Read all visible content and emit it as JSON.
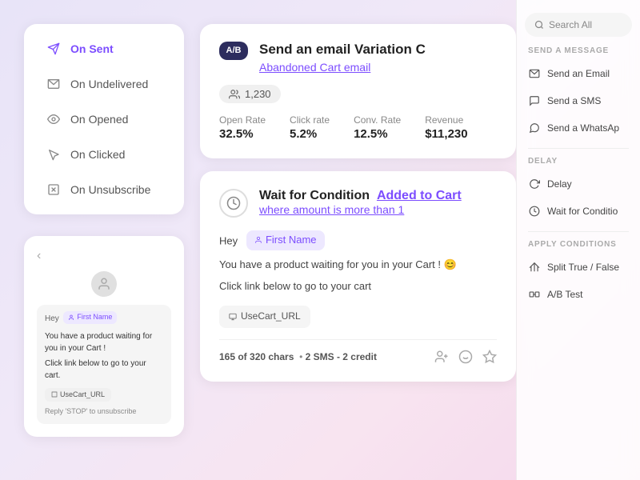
{
  "sidebar": {
    "items": [
      {
        "id": "on-sent",
        "label": "On Sent",
        "active": true
      },
      {
        "id": "on-undelivered",
        "label": "On Undelivered",
        "active": false
      },
      {
        "id": "on-opened",
        "label": "On Opened",
        "active": false
      },
      {
        "id": "on-clicked",
        "label": "On Clicked",
        "active": false
      },
      {
        "id": "on-unsubscribe",
        "label": "On Unsubscribe",
        "active": false
      }
    ]
  },
  "preview": {
    "back": "‹",
    "hey": "Hey",
    "name_placeholder": "First Name",
    "body1": "You have a product waiting for you in your Cart !",
    "body2": "Click link below to go to your cart.",
    "url": "UseCart_URL",
    "reply": "Reply 'STOP' to unsubscribe"
  },
  "top_card": {
    "ab_label": "A/B",
    "title": "Send an email Variation C",
    "subtitle": "Abandoned Cart email",
    "subscribers": "1,230",
    "stats": [
      {
        "label": "Open Rate",
        "value": "32.5%"
      },
      {
        "label": "Click rate",
        "value": "5.2%"
      },
      {
        "label": "Conv. Rate",
        "value": "12.5%"
      },
      {
        "label": "Revenue",
        "value": "$11,230"
      }
    ]
  },
  "bottom_card": {
    "condition_title": "Wait for Condition",
    "condition_link": "Added to Cart",
    "condition_sub": "where amount is more than 1",
    "hey": "Hey",
    "name_placeholder": "First Name",
    "body1": "You have a product waiting for you in your Cart ! 😊",
    "body2": "Click link below to go to your cart",
    "url": "UseCart_URL",
    "footer_chars": "165 of 320 chars",
    "footer_sms": "2 SMS - 2 credit"
  },
  "right_panel": {
    "search_placeholder": "Search All",
    "section_message": "SEND A MESSAGE",
    "items_message": [
      {
        "label": "Send an Email",
        "icon": "email"
      },
      {
        "label": "Send a SMS",
        "icon": "sms"
      },
      {
        "label": "Send a WhatsAp",
        "icon": "whatsapp"
      }
    ],
    "section_delay": "DELAY",
    "items_delay": [
      {
        "label": "Delay",
        "icon": "delay"
      },
      {
        "label": "Wait for Conditio",
        "icon": "clock"
      }
    ],
    "section_conditions": "APPLY CONDITIONS",
    "items_conditions": [
      {
        "label": "Split True / False",
        "icon": "split"
      },
      {
        "label": "A/B Test",
        "icon": "ab"
      }
    ]
  }
}
